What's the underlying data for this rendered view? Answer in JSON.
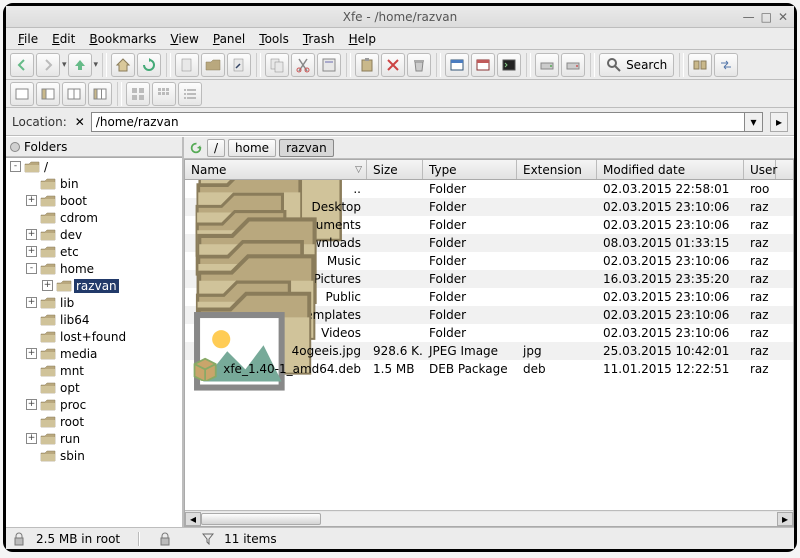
{
  "window": {
    "title": "Xfe - /home/razvan",
    "controls": {
      "minimize": "—",
      "maximize": "□",
      "close": "✕"
    }
  },
  "menus": [
    {
      "label": "File",
      "u": "F"
    },
    {
      "label": "Edit",
      "u": "E"
    },
    {
      "label": "Bookmarks",
      "u": "B"
    },
    {
      "label": "View",
      "u": "V"
    },
    {
      "label": "Panel",
      "u": "P"
    },
    {
      "label": "Tools",
      "u": "T"
    },
    {
      "label": "Trash",
      "u": "T"
    },
    {
      "label": "Help",
      "u": "H"
    }
  ],
  "toolbar": {
    "search_label": "Search"
  },
  "location": {
    "label": "Location:",
    "value": "/home/razvan"
  },
  "sidebar": {
    "title": "Folders",
    "tree": [
      {
        "depth": 0,
        "exp": "-",
        "label": "/",
        "sel": false
      },
      {
        "depth": 1,
        "exp": "",
        "label": "bin",
        "sel": false
      },
      {
        "depth": 1,
        "exp": "+",
        "label": "boot",
        "sel": false
      },
      {
        "depth": 1,
        "exp": "",
        "label": "cdrom",
        "sel": false
      },
      {
        "depth": 1,
        "exp": "+",
        "label": "dev",
        "sel": false
      },
      {
        "depth": 1,
        "exp": "+",
        "label": "etc",
        "sel": false
      },
      {
        "depth": 1,
        "exp": "-",
        "label": "home",
        "sel": false
      },
      {
        "depth": 2,
        "exp": "+",
        "label": "razvan",
        "sel": true
      },
      {
        "depth": 1,
        "exp": "+",
        "label": "lib",
        "sel": false
      },
      {
        "depth": 1,
        "exp": "",
        "label": "lib64",
        "sel": false
      },
      {
        "depth": 1,
        "exp": "",
        "label": "lost+found",
        "sel": false
      },
      {
        "depth": 1,
        "exp": "+",
        "label": "media",
        "sel": false
      },
      {
        "depth": 1,
        "exp": "",
        "label": "mnt",
        "sel": false
      },
      {
        "depth": 1,
        "exp": "",
        "label": "opt",
        "sel": false
      },
      {
        "depth": 1,
        "exp": "+",
        "label": "proc",
        "sel": false
      },
      {
        "depth": 1,
        "exp": "",
        "label": "root",
        "sel": false
      },
      {
        "depth": 1,
        "exp": "+",
        "label": "run",
        "sel": false
      },
      {
        "depth": 1,
        "exp": "",
        "label": "sbin",
        "sel": false
      }
    ]
  },
  "path_bar": {
    "segments": [
      {
        "label": "/",
        "active": false
      },
      {
        "label": "home",
        "active": false
      },
      {
        "label": "razvan",
        "active": true
      }
    ]
  },
  "file_list": {
    "columns": [
      {
        "key": "name",
        "label": "Name",
        "w": "col-name",
        "sort": true
      },
      {
        "key": "size",
        "label": "Size",
        "w": "col-size"
      },
      {
        "key": "type",
        "label": "Type",
        "w": "col-type"
      },
      {
        "key": "ext",
        "label": "Extension",
        "w": "col-ext"
      },
      {
        "key": "mod",
        "label": "Modified date",
        "w": "col-mod"
      },
      {
        "key": "user",
        "label": "User",
        "w": "col-user"
      }
    ],
    "rows": [
      {
        "icon": "folder-up",
        "name": "..",
        "size": "",
        "type": "Folder",
        "ext": "",
        "mod": "02.03.2015 22:58:01",
        "user": "roo"
      },
      {
        "icon": "folder",
        "name": "Desktop",
        "size": "",
        "type": "Folder",
        "ext": "",
        "mod": "02.03.2015 23:10:06",
        "user": "raz"
      },
      {
        "icon": "folder",
        "name": "Documents",
        "size": "",
        "type": "Folder",
        "ext": "",
        "mod": "02.03.2015 23:10:06",
        "user": "raz"
      },
      {
        "icon": "folder",
        "name": "Downloads",
        "size": "",
        "type": "Folder",
        "ext": "",
        "mod": "08.03.2015 01:33:15",
        "user": "raz"
      },
      {
        "icon": "folder",
        "name": "Music",
        "size": "",
        "type": "Folder",
        "ext": "",
        "mod": "02.03.2015 23:10:06",
        "user": "raz"
      },
      {
        "icon": "folder",
        "name": "Pictures",
        "size": "",
        "type": "Folder",
        "ext": "",
        "mod": "16.03.2015 23:35:20",
        "user": "raz"
      },
      {
        "icon": "folder",
        "name": "Public",
        "size": "",
        "type": "Folder",
        "ext": "",
        "mod": "02.03.2015 23:10:06",
        "user": "raz"
      },
      {
        "icon": "folder",
        "name": "Templates",
        "size": "",
        "type": "Folder",
        "ext": "",
        "mod": "02.03.2015 23:10:06",
        "user": "raz"
      },
      {
        "icon": "folder",
        "name": "Videos",
        "size": "",
        "type": "Folder",
        "ext": "",
        "mod": "02.03.2015 23:10:06",
        "user": "raz"
      },
      {
        "icon": "image",
        "name": "4ogeeis.jpg",
        "size": "928.6 K...",
        "type": "JPEG Image",
        "ext": "jpg",
        "mod": "25.03.2015 10:42:01",
        "user": "raz"
      },
      {
        "icon": "package",
        "name": "xfe_1.40-1_amd64.deb",
        "size": "1.5 MB",
        "type": "DEB Package",
        "ext": "deb",
        "mod": "11.01.2015 12:22:51",
        "user": "raz"
      }
    ]
  },
  "status": {
    "left": "2.5 MB in root",
    "filter": "11 items"
  }
}
